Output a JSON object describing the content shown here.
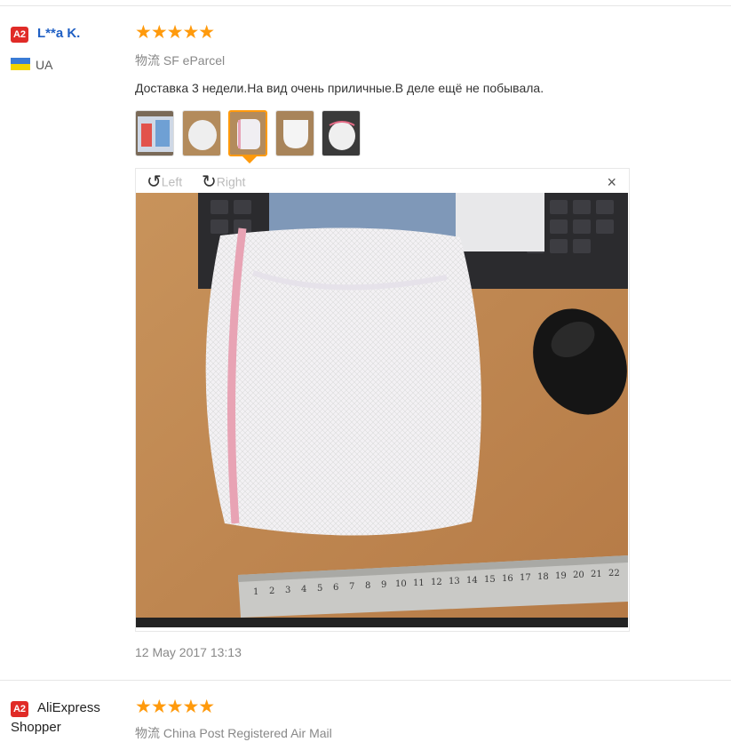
{
  "review1": {
    "badge": "A2",
    "user": "L**a K.",
    "country": "UA",
    "stars": "★★★★★",
    "logistics": "物流 SF eParcel",
    "text": "Доставка 3 недели.На вид очень приличные.В деле ещё не побывала.",
    "thumb_count": 5,
    "active_thumb": 3,
    "viewer": {
      "rotate_left_icon": "↺",
      "rotate_left": "Left",
      "rotate_right_icon": "↻",
      "rotate_right": "Right",
      "close": "×"
    },
    "date": "12 May 2017 13:13"
  },
  "review2": {
    "badge": "A2",
    "user_line1": "AliExpress",
    "user_line2": "Shopper",
    "stars": "★★★★★",
    "logistics": "物流 China Post Registered Air Mail"
  },
  "colors": {
    "badge": "#e02b27",
    "name": "#1f5fc4",
    "star": "#ff9a0c",
    "accent": "#ff9a0c"
  }
}
